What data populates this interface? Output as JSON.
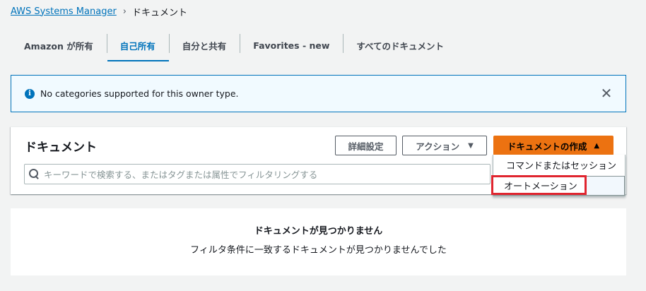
{
  "breadcrumb": {
    "root": "AWS Systems Manager",
    "separator": "›",
    "current": "ドキュメント"
  },
  "tabs": [
    {
      "label": "Amazon が所有",
      "active": false
    },
    {
      "label": "自己所有",
      "active": true
    },
    {
      "label": "自分と共有",
      "active": false
    },
    {
      "label": "Favorites - new",
      "active": false
    },
    {
      "label": "すべてのドキュメント",
      "active": false
    }
  ],
  "flash": {
    "icon": "info-icon",
    "icon_glyph": "i",
    "message": "No categories supported for this owner type.",
    "close_glyph": "✕"
  },
  "panel": {
    "title": "ドキュメント",
    "detail_button": "詳細設定",
    "action_button": "アクション",
    "action_caret": "▼",
    "create_button": "ドキュメントの作成",
    "create_caret": "▲",
    "search_placeholder": "キーワードで検索する、またはタグまたは属性でフィルタリングする"
  },
  "dropdown": {
    "items": [
      {
        "label": "コマンドまたはセッション"
      },
      {
        "label": "オートメーション"
      }
    ]
  },
  "empty_state": {
    "title": "ドキュメントが見つかりません",
    "description": "フィルタ条件に一致するドキュメントが見つかりませんでした"
  },
  "colors": {
    "link": "#0073bb",
    "primary_button": "#ec7211",
    "highlight_border": "#e0252f",
    "background": "#f2f3f3"
  }
}
